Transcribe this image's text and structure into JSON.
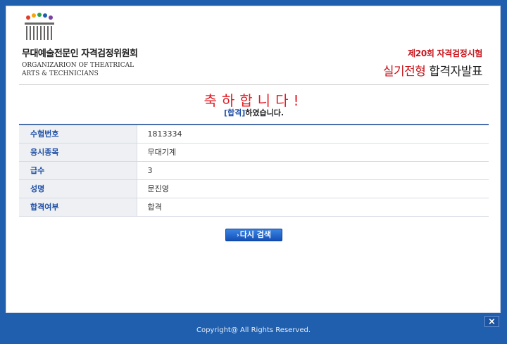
{
  "header": {
    "org_name_kr": "무대예술전문인 자격검정위원회",
    "org_name_en_line1": "ORGANIZARION OF THEATRICAL",
    "org_name_en_line2": "ARTS & TECHNICIANS",
    "exam_title": "제20회 자격검정시험",
    "result_title_part1": "실기전형",
    "result_title_part2": "합격자발표"
  },
  "message": {
    "congrats": "축하합니다!",
    "pass_bracket": "[합격]",
    "pass_suffix": "하였습니다."
  },
  "info_rows": [
    {
      "label": "수험번호",
      "value": "1813334"
    },
    {
      "label": "응시종목",
      "value": "무대기계"
    },
    {
      "label": "급수",
      "value": "3"
    },
    {
      "label": "성명",
      "value": "문진영"
    },
    {
      "label": "합격여부",
      "value": "합격"
    }
  ],
  "buttons": {
    "search_again_arrow": "›",
    "search_again": "다시 검색",
    "close": "×"
  },
  "footer": {
    "copyright": "Copyright@ All Rights Reserved."
  },
  "colors": {
    "frame_blue": "#1f5fae",
    "accent_red": "#c8161d",
    "label_blue": "#1e4fa6"
  }
}
